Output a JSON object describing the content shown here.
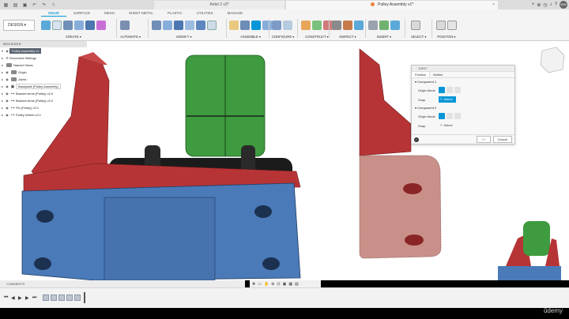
{
  "titlebar": {
    "left_tab": "Artist 2 v3*",
    "active_tab": "Pulley Assembly v1*",
    "avatar": "WW"
  },
  "ribbon": {
    "mode_button": "DESIGN",
    "tabs": [
      "SOLID",
      "SURFACE",
      "MESH",
      "SHEET METAL",
      "PLASTIC",
      "UTILITIES",
      "MANAGE"
    ],
    "groups": {
      "create": "CREATE",
      "automate": "AUTOMATE",
      "modify": "MODIFY",
      "assemble": "ASSEMBLE",
      "configure": "CONFIGURE",
      "construct": "CONSTRUCT",
      "inspect": "INSPECT",
      "insert": "INSERT",
      "select": "SELECT",
      "position": "POSITION"
    }
  },
  "browser": {
    "header": "BROWSER",
    "root": "Pulley Assembly v1",
    "items": [
      "Document Settings",
      "Named Views",
      "Origin",
      "Joints",
      "Baseplate (Pulley Assembly)",
      "Bracket Arms (Pulley) v2:4",
      "Bracket Arms (Pulley) v2:2",
      "Pin (Pulley) v2:1",
      "Pulley Wheel v2:1"
    ]
  },
  "joint_dialog": {
    "title": "JOINT",
    "tabs": [
      "Position",
      "Motion"
    ],
    "component1": {
      "heading": "Component 1",
      "origin_mode_label": "Origin Mode",
      "snap_label": "Snap",
      "snap_value": "Select"
    },
    "component2": {
      "heading": "Component 2",
      "origin_mode_label": "Origin Mode",
      "snap_label": "Snap",
      "snap_value": "Select"
    },
    "ok": "OK",
    "cancel": "Cancel"
  },
  "comments": "COMMENTS",
  "watermark": "ûdemy",
  "colors": {
    "accent": "#0696d7",
    "part_red": "#b73436",
    "part_blue": "#4a7ab8",
    "part_green": "#3e9b3f",
    "part_black": "#1b1b1b",
    "part_pink": "#c99089"
  }
}
